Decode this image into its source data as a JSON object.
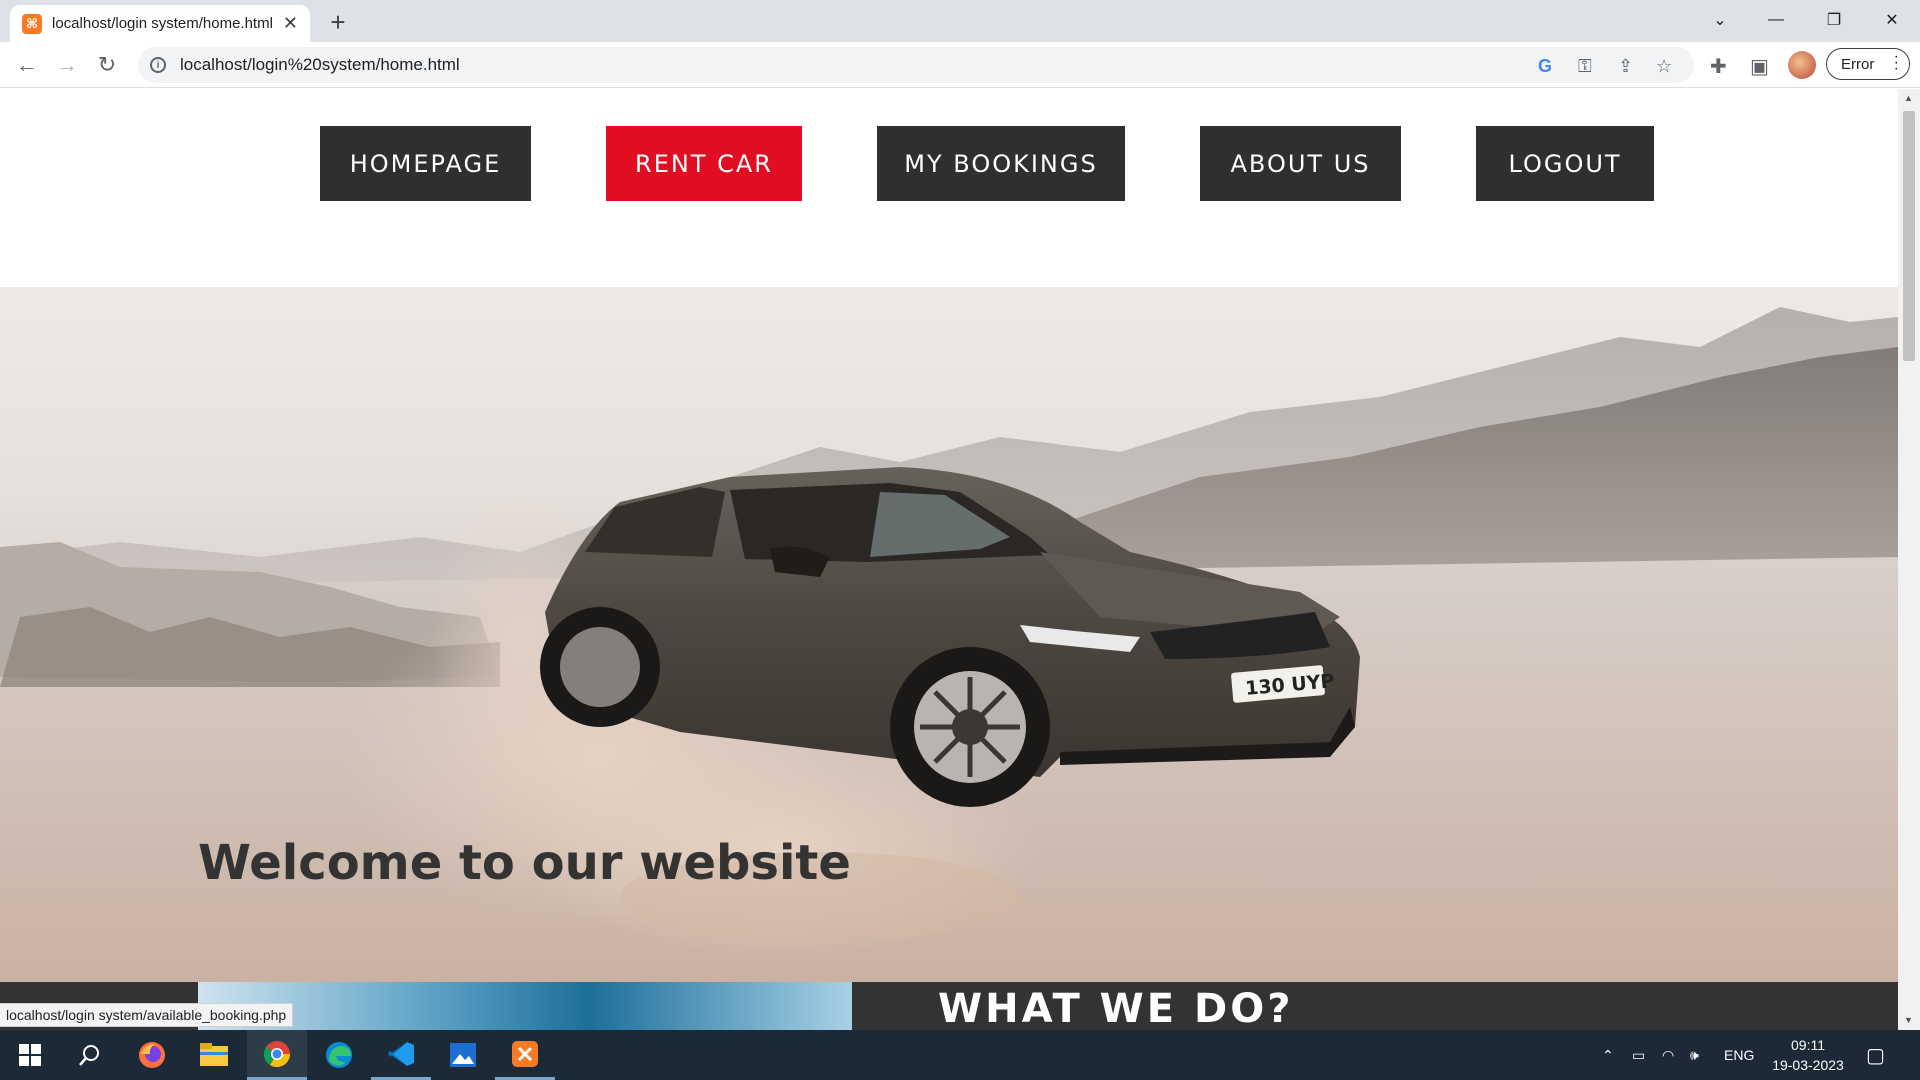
{
  "browser": {
    "tab_title": "localhost/login system/home.html",
    "url": "localhost/login%20system/home.html",
    "profile_button_label": "Error",
    "status_bar_url": "localhost/login system/available_booking.php"
  },
  "site": {
    "nav": [
      {
        "label": "HOMEPAGE",
        "active": false
      },
      {
        "label": "RENT CAR",
        "active": true
      },
      {
        "label": "MY BOOKINGS",
        "active": false
      },
      {
        "label": "ABOUT US",
        "active": false
      },
      {
        "label": "LOGOUT",
        "active": false
      }
    ],
    "hero": {
      "welcome_text": "Welcome to our website",
      "plate_text": "130 UYP"
    },
    "section": {
      "heading_light": "WHAT ",
      "heading_bold": "WE DO?"
    }
  },
  "taskbar": {
    "apps": [
      "start-icon",
      "search-icon",
      "firefox-icon",
      "file-explorer-icon",
      "chrome-icon",
      "edge-icon",
      "vscode-icon",
      "photos-icon",
      "xampp-icon"
    ],
    "language": "ENG",
    "time": "09:11",
    "date": "19-03-2023"
  },
  "colors": {
    "nav_bg": "#2f2f2f",
    "nav_active": "#e10d22",
    "section_band": "#333333"
  }
}
